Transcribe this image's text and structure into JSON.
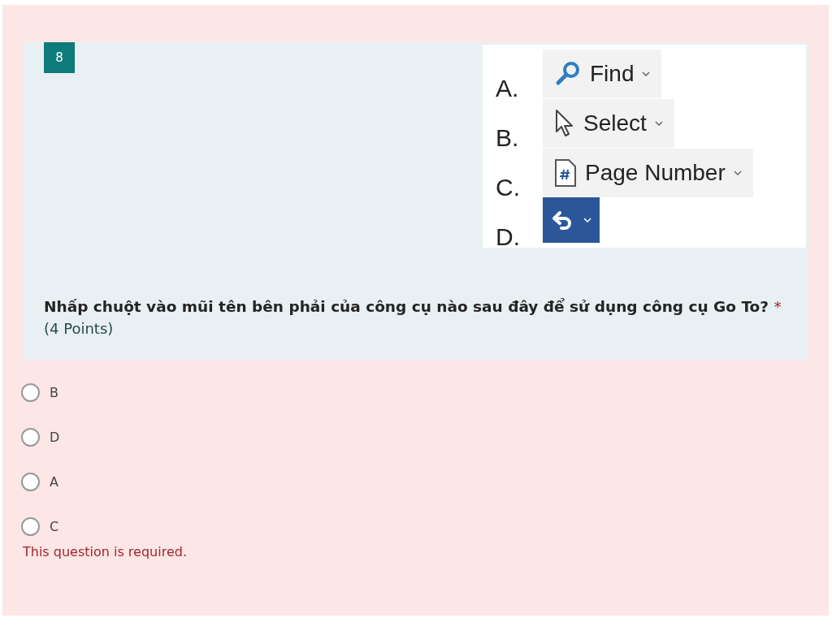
{
  "question": {
    "number": "8",
    "title": "Nhấp chuột vào mũi tên bên phải của công cụ nào sau đây để sử dụng công cụ Go To?",
    "required_mark": "*",
    "points": "(4 Points)",
    "image": {
      "rows": [
        {
          "letter": "A.",
          "kind": "find",
          "label": "Find"
        },
        {
          "letter": "B.",
          "kind": "select",
          "label": "Select"
        },
        {
          "letter": "C.",
          "kind": "page",
          "label": "Page Number"
        },
        {
          "letter": "D.",
          "kind": "undo"
        }
      ]
    }
  },
  "options": [
    {
      "label": "B",
      "selected": false
    },
    {
      "label": "D",
      "selected": false
    },
    {
      "label": "A",
      "selected": false
    },
    {
      "label": "C",
      "selected": false
    }
  ],
  "error": "This question is required."
}
